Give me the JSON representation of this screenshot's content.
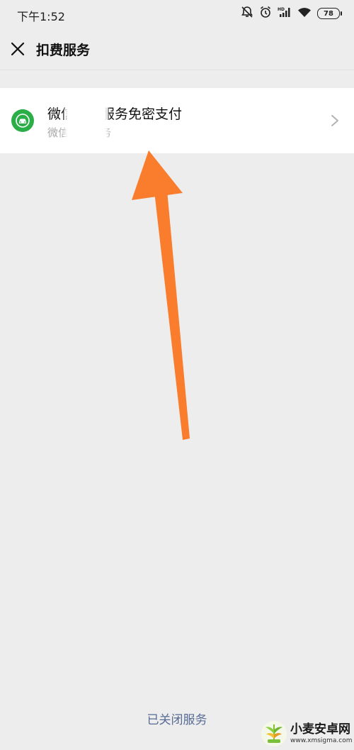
{
  "status": {
    "time": "下午1:52",
    "battery": "78",
    "icons": [
      "mute-bell-icon",
      "alarm-icon",
      "hd-signal-icon",
      "wifi-icon",
      "battery-icon"
    ]
  },
  "nav": {
    "title": "扣费服务",
    "close_icon": "close-icon"
  },
  "service": {
    "title": "微信　　服务免密支付",
    "subtitle": "微信　　服务",
    "icon": "car-icon",
    "chevron": "chevron-right-icon"
  },
  "footer": {
    "closed_link": "已关闭服务"
  },
  "watermark": {
    "title": "小麦安卓网",
    "url": "www.xmsigma.com"
  },
  "colors": {
    "background": "#ededed",
    "card": "#ffffff",
    "service_icon": "#2aae48",
    "link": "#576b95",
    "annotation_arrow": "#f97d2c"
  }
}
